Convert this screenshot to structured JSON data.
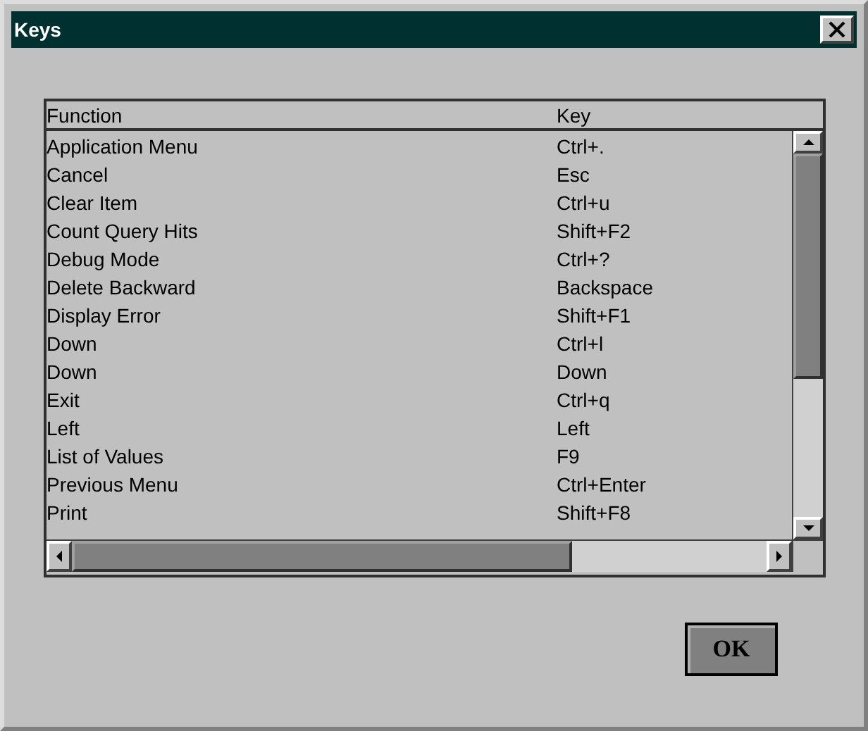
{
  "window": {
    "title": "Keys"
  },
  "table": {
    "columns": [
      "Function",
      "Key"
    ],
    "rows": [
      [
        "Application Menu",
        "Ctrl+."
      ],
      [
        "Cancel",
        "Esc"
      ],
      [
        "Clear Item",
        "Ctrl+u"
      ],
      [
        "Count Query Hits",
        "Shift+F2"
      ],
      [
        "Debug Mode",
        "Ctrl+?"
      ],
      [
        "Delete Backward",
        "Backspace"
      ],
      [
        "Display Error",
        "Shift+F1"
      ],
      [
        "Down",
        "Ctrl+l"
      ],
      [
        "Down",
        "Down"
      ],
      [
        "Exit",
        "Ctrl+q"
      ],
      [
        "Left",
        "Left"
      ],
      [
        "List of Values",
        "F9"
      ],
      [
        "Previous Menu",
        "Ctrl+Enter"
      ],
      [
        "Print",
        "Shift+F8"
      ]
    ]
  },
  "buttons": [
    "OK"
  ]
}
